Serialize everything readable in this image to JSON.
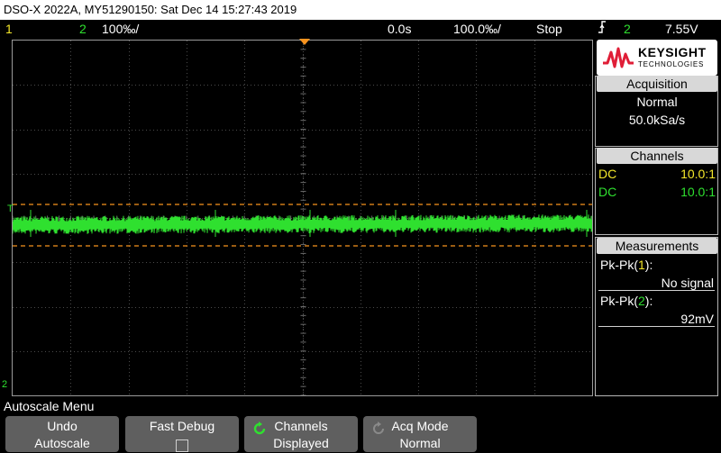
{
  "title": "DSO-X 2022A, MY51290150: Sat Dec 14 15:27:43 2019",
  "status": {
    "ch1_num": "1",
    "ch2_num": "2",
    "ch2_scale": "100‰/",
    "time_delay": "0.0s",
    "time_scale": "100.0‰/",
    "run_state": "Stop",
    "trig_source": "2",
    "trig_level": "7.55V"
  },
  "markers": {
    "trigger_level": "T",
    "channel2_ground": "2"
  },
  "logo": {
    "name": "KEYSIGHT",
    "sub": "TECHNOLOGIES"
  },
  "acquisition": {
    "header": "Acquisition",
    "mode": "Normal",
    "rate": "50.0kSa/s"
  },
  "channels": {
    "header": "Channels",
    "rows": [
      {
        "coupling": "DC",
        "probe": "10.0:1"
      },
      {
        "coupling": "DC",
        "probe": "10.0:1"
      }
    ]
  },
  "measurements": {
    "header": "Measurements",
    "items": [
      {
        "label_pre": "Pk-Pk(",
        "channel": "1",
        "label_post": "):",
        "value": "No signal"
      },
      {
        "label_pre": "Pk-Pk(",
        "channel": "2",
        "label_post": "):",
        "value": "92mV"
      }
    ]
  },
  "menu": {
    "title": "Autoscale Menu",
    "softkeys": [
      {
        "line1": "Undo",
        "line2": "Autoscale"
      },
      {
        "line1": "Fast Debug",
        "line2": ""
      },
      {
        "line1": "Channels",
        "line2": "Displayed"
      },
      {
        "line1": "Acq Mode",
        "line2": "Normal"
      }
    ]
  },
  "colors": {
    "ch1": "#f4e72a",
    "ch2": "#2fe02f",
    "cursor": "#f7931e",
    "brand": "#e01e37"
  }
}
